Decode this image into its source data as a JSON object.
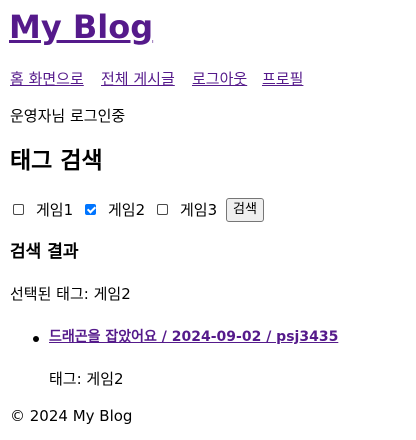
{
  "header": {
    "title": "My Blog",
    "nav": {
      "home": "홈 화면으로",
      "all_posts": "전체 게시글",
      "logout": "로그아웃",
      "profile": "프로필"
    }
  },
  "login_status": "운영자님 로그인중",
  "tag_search": {
    "heading": "태그 검색",
    "options": [
      {
        "label": "게임1",
        "checked": false
      },
      {
        "label": "게임2",
        "checked": true
      },
      {
        "label": "게임3",
        "checked": false
      }
    ],
    "search_button": "검색"
  },
  "results": {
    "heading": "검색 결과",
    "selected_tags": "선택된 태그: 게임2",
    "posts": [
      {
        "link_text": "드래곤을 잡았어요 / 2024-09-02 / psj3435",
        "tags": "태그: 게임2"
      }
    ]
  },
  "footer": "© 2024 My Blog",
  "colors": {
    "link": "#551a8b",
    "checkbox_checked": "#0075ff"
  }
}
